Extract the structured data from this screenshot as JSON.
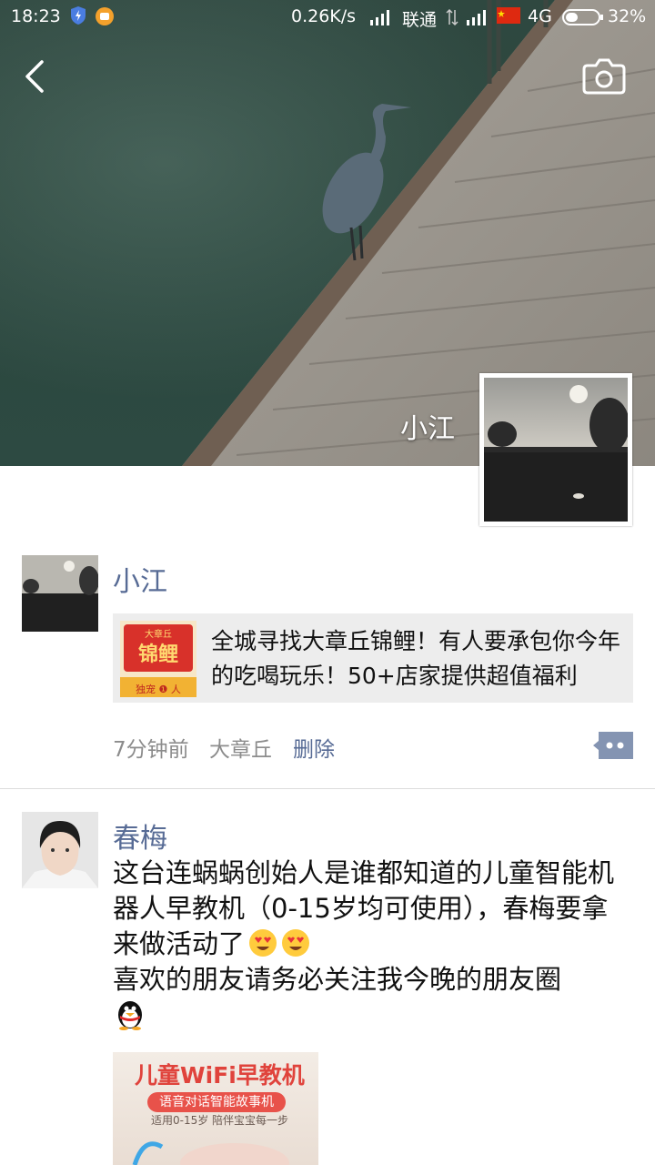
{
  "status_bar": {
    "time": "18:23",
    "speed": "0.26K/s",
    "carrier": "联通",
    "network": "4G",
    "battery": "32%"
  },
  "cover": {
    "username": "小江"
  },
  "posts": [
    {
      "name": "小江",
      "share": {
        "text": "全城寻找大章丘锦鲤！有人要承包你今年的吃喝玩乐！50+店家提供超值福利",
        "thumb_top": "大章丘",
        "thumb_main": "锦鲤",
        "thumb_bottom": "独宠 ❶ 人"
      },
      "time": "7分钟前",
      "location": "大章丘",
      "delete_label": "删除"
    },
    {
      "name": "春梅",
      "text": "这台连蜗蜗创始人是谁都知道的儿童智能机器人早教机（0-15岁均可使用），春梅要拿来做活动了",
      "text2": "喜欢的朋友请务必关注我今晚的朋友圈",
      "image": {
        "title": "儿童WiFi早教机",
        "subtitle": "语音对话智能故事机",
        "small": "适用0-15岁  陪伴宝宝每一步"
      }
    }
  ],
  "icons": {
    "back": "back-arrow-icon",
    "camera": "camera-icon",
    "comment": "comment-icon"
  },
  "colors": {
    "name_blue": "#576b95",
    "card_bg": "#ededed"
  }
}
